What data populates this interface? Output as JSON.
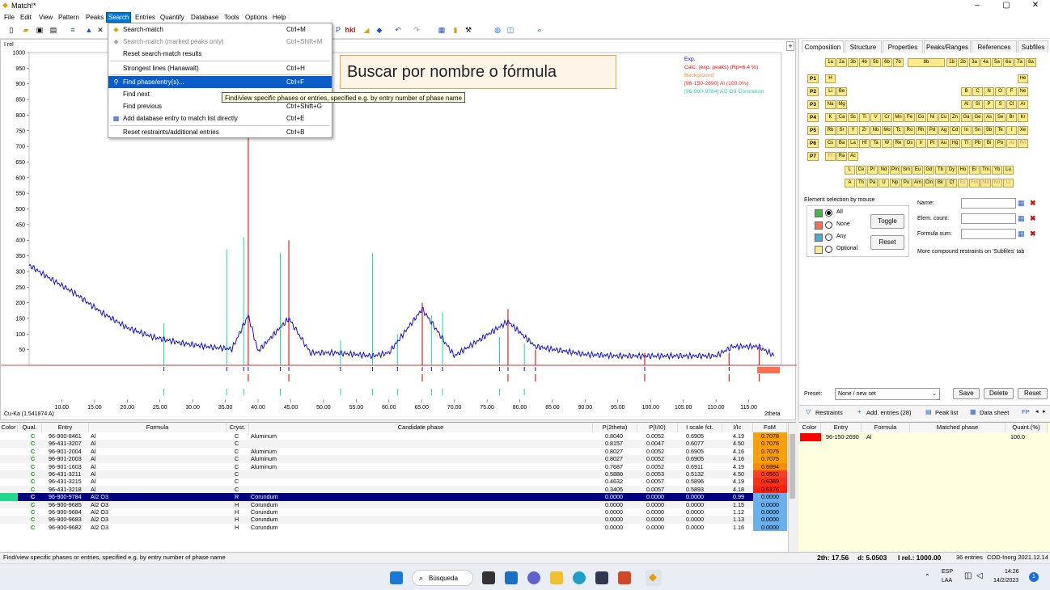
{
  "app": {
    "title": "Match!*",
    "minimize": "–",
    "maximize": "▢",
    "close": "✕"
  },
  "menubar": [
    "File",
    "Edit",
    "View",
    "Pattern",
    "Peaks",
    "Search",
    "Entries",
    "Quantify",
    "Database",
    "Tools",
    "Options",
    "Help"
  ],
  "search_menu": {
    "items": [
      {
        "label": "Search-match",
        "shortcut": "Ctrl+M",
        "state": "normal",
        "icon": "diamond-icon"
      },
      {
        "label": "Search-match (marked peaks only)",
        "shortcut": "Ctrl+Shift+M",
        "state": "disabled",
        "icon": "diamond-gray-icon"
      },
      {
        "label": "Reset search-match results",
        "shortcut": "",
        "state": "normal",
        "icon": ""
      },
      {
        "label": "Strongest lines (Hanawalt)",
        "shortcut": "Ctrl+H",
        "state": "normal",
        "icon": ""
      },
      {
        "label": "Find phase/entry(s)...",
        "shortcut": "Ctrl+F",
        "state": "highlighted",
        "icon": "magnifier-icon"
      },
      {
        "label": "Find next",
        "shortcut": "",
        "state": "normal",
        "icon": ""
      },
      {
        "label": "Find previous",
        "shortcut": "Ctrl+Shift+G",
        "state": "normal",
        "icon": ""
      },
      {
        "label": "Add database entry to match list directly",
        "shortcut": "Ctrl+E",
        "state": "normal",
        "icon": "add-entry-icon"
      },
      {
        "label": "Reset restraints/additional entries",
        "shortcut": "Ctrl+B",
        "state": "normal",
        "icon": ""
      }
    ],
    "tooltip": "Find/view specific phases or entries, specified e.g. by entry number of phase name"
  },
  "annotation": "Buscar por nombre o fórmula",
  "plot": {
    "ylabel": "I rel",
    "yticks": [
      "1000",
      "950",
      "900",
      "850",
      "800",
      "750",
      "700",
      "650",
      "600",
      "550",
      "500",
      "450",
      "400",
      "350",
      "300",
      "250",
      "200",
      "150",
      "100",
      "50"
    ],
    "xticks": [
      "10.00",
      "15.00",
      "20.00",
      "25.00",
      "30.00",
      "35.00",
      "40.00",
      "45.00",
      "50.00",
      "55.00",
      "60.00",
      "65.00",
      "70.00",
      "75.00",
      "80.00",
      "85.00",
      "90.00",
      "95.00",
      "100.00",
      "105.00",
      "110.00",
      "115.00"
    ],
    "xunit": "2theta",
    "wavelength": "Cu-Ka (1.541874 A)",
    "legend": [
      {
        "text": "Exp.",
        "color": "#0000ff"
      },
      {
        "text": "Calc. (exp. peaks) (Rp=6.4 %)",
        "color": "#ff0000"
      },
      {
        "text": "Background",
        "color": "#ff8c40"
      },
      {
        "text": "[96-150-2690] Al  (100.0%)",
        "color": "#ff2020"
      },
      {
        "text": "[96-900-9784] Al2 O3 Corundum",
        "color": "#20d0a0"
      }
    ]
  },
  "chart_data": {
    "type": "line",
    "xlabel": "2theta",
    "ylabel": "I rel",
    "xlim": [
      5,
      120
    ],
    "ylim": [
      0,
      1000
    ],
    "series": [
      {
        "name": "Exp.",
        "x": [
          5,
          8,
          12,
          16,
          20,
          24,
          28,
          32,
          36,
          38.5,
          40,
          44.7,
          48,
          52,
          57.5,
          60,
          65.1,
          70,
          78.2,
          82.4,
          90,
          95,
          100,
          110,
          112.5,
          116.5,
          119
        ],
        "values": [
          320,
          280,
          230,
          170,
          120,
          90,
          72,
          60,
          52,
          160,
          45,
          150,
          40,
          40,
          30,
          40,
          180,
          30,
          140,
          60,
          35,
          30,
          30,
          30,
          60,
          60,
          30
        ]
      }
    ],
    "peaks_al": [
      38.5,
      44.7,
      65.1,
      78.2,
      82.4,
      99.1,
      112.0,
      116.6
    ],
    "peaks_corundum": [
      25.6,
      35.2,
      37.8,
      43.4,
      52.6,
      57.5,
      61.3,
      66.5,
      68.2,
      76.9,
      80.7
    ]
  },
  "right_panel": {
    "tabs": [
      "Composition",
      "Structure",
      "Properties",
      "Peaks/Ranges",
      "References",
      "Subfiles"
    ],
    "groups": [
      "1a",
      "2a",
      "3b",
      "4b",
      "5b",
      "6b",
      "7b",
      "8b",
      "1b",
      "2b",
      "3a",
      "4a",
      "5a",
      "6a",
      "7a",
      "8a"
    ],
    "periods": [
      "P1",
      "P2",
      "P3",
      "P4",
      "P5",
      "P6",
      "P7"
    ],
    "rows": [
      [
        "H",
        "",
        "",
        "",
        "",
        "",
        "",
        "",
        "",
        "",
        "",
        "",
        "",
        "",
        "",
        "",
        "",
        "He"
      ],
      [
        "Li",
        "Be",
        "",
        "",
        "",
        "",
        "",
        "",
        "",
        "",
        "",
        "",
        "B",
        "C",
        "N",
        "O",
        "F",
        "Ne"
      ],
      [
        "Na",
        "Mg",
        "",
        "",
        "",
        "",
        "",
        "",
        "",
        "",
        "",
        "",
        "Al",
        "Si",
        "P",
        "S",
        "Cl",
        "Ar"
      ],
      [
        "K",
        "Ca",
        "Sc",
        "Ti",
        "V",
        "Cr",
        "Mn",
        "Fe",
        "Co",
        "Ni",
        "Cu",
        "Zn",
        "Ga",
        "Ge",
        "As",
        "Se",
        "Br",
        "Kr"
      ],
      [
        "Rb",
        "Sr",
        "Y",
        "Zr",
        "Nb",
        "Mo",
        "Tc",
        "Ru",
        "Rh",
        "Pd",
        "Ag",
        "Cd",
        "In",
        "Sn",
        "Sb",
        "Te",
        "I",
        "Xe"
      ],
      [
        "Cs",
        "Ba",
        "La",
        "Hf",
        "Ta",
        "W",
        "Re",
        "Os",
        "Ir",
        "Pt",
        "Au",
        "Hg",
        "Tl",
        "Pb",
        "Bi",
        "Po",
        "At",
        "Rn"
      ],
      [
        "Fr",
        "Ra",
        "Ac",
        "",
        "",
        "",
        "",
        "",
        "",
        "",
        "",
        "",
        "",
        "",
        "",
        "",
        "",
        ""
      ]
    ],
    "lanth": [
      "L",
      "Ce",
      "Pr",
      "Nd",
      "Pm",
      "Sm",
      "Eu",
      "Gd",
      "Tb",
      "Dy",
      "Ho",
      "Er",
      "Tm",
      "Yb",
      "Lu"
    ],
    "actin": [
      "A",
      "Th",
      "Pa",
      "U",
      "Np",
      "Pu",
      "Am",
      "Cm",
      "Bk",
      "Cf",
      "Es",
      "Fm",
      "Md",
      "No",
      "Lr"
    ],
    "selection_title": "Element selection by mouse",
    "radio": [
      "All",
      "None",
      "Any",
      "Optional"
    ],
    "toggle": "Toggle",
    "reset": "Reset",
    "fields": [
      "Name:",
      "Elem. count:",
      "Formula sum:"
    ],
    "more": "More compound restraints on 'Subfiles' tab",
    "preset_label": "Preset:",
    "preset_value": "None / new set",
    "save": "Save",
    "delete": "Delete",
    "reset_btn": "Reset",
    "bottom_tabs": [
      "Restraints",
      "Add. entries (28)",
      "Peak list",
      "Data sheet",
      "FP"
    ]
  },
  "table": {
    "headers": [
      "Color",
      "Qual.",
      "Entry",
      "Formula",
      "Cryst.",
      "Candidate phase",
      "P(2theta)",
      "P(I/I0)",
      "I scale fct.",
      "I/Ic",
      "FoM"
    ],
    "rows": [
      [
        "C",
        "96-900-8461",
        "Al",
        "C",
        "Aluminum",
        "0.8040",
        "0.0052",
        "0.6905",
        "4.19",
        "0.7078",
        "#ffa000"
      ],
      [
        "C",
        "96-431-3207",
        "Al",
        "C",
        "",
        "0.8157",
        "0.0047",
        "0.6077",
        "4.50",
        "0.7076",
        "#ffa000"
      ],
      [
        "C",
        "96-901-2004",
        "Al",
        "C",
        "Aluminum",
        "0.8027",
        "0.0052",
        "0.6905",
        "4.16",
        "0.7075",
        "#ffa000"
      ],
      [
        "C",
        "96-901-2003",
        "Al",
        "C",
        "Aluminum",
        "0.8027",
        "0.0052",
        "0.6905",
        "4.16",
        "0.7075",
        "#ffa000"
      ],
      [
        "C",
        "96-901-1603",
        "Al",
        "C",
        "Aluminum",
        "0.7687",
        "0.0052",
        "0.6911",
        "4.19",
        "0.6994",
        "#ff8c00"
      ],
      [
        "C",
        "96-431-3211",
        "Al",
        "C",
        "",
        "0.5880",
        "0.0053",
        "0.5132",
        "4.50",
        "0.6563",
        "#ff4020"
      ],
      [
        "C",
        "96-431-3215",
        "Al",
        "C",
        "",
        "0.4632",
        "0.0057",
        "0.5896",
        "4.19",
        "0.6389",
        "#ff3018"
      ],
      [
        "C",
        "96-431-3218",
        "Al",
        "C",
        "",
        "0.3405",
        "0.0057",
        "0.5893",
        "4.18",
        "0.6176",
        "#ff2010"
      ],
      [
        "C",
        "96-900-9784",
        "Al2 O3",
        "R",
        "Corundum",
        "0.0000",
        "0.0000",
        "0.0000",
        "0.99",
        "0.0000",
        "#6ab0ee"
      ],
      [
        "C",
        "96-900-9685",
        "Al2 O3",
        "H",
        "Corundum",
        "0.0000",
        "0.0000",
        "0.0000",
        "1.15",
        "0.0000",
        "#6ab0ee"
      ],
      [
        "C",
        "96-900-9684",
        "Al2 O3",
        "H",
        "Corundum",
        "0.0000",
        "0.0000",
        "0.0000",
        "1.12",
        "0.0000",
        "#6ab0ee"
      ],
      [
        "C",
        "96-900-9683",
        "Al2 O3",
        "H",
        "Corundum",
        "0.0000",
        "0.0000",
        "0.0000",
        "1.13",
        "0.0000",
        "#6ab0ee"
      ],
      [
        "C",
        "96-900-9682",
        "Al2 O3",
        "H",
        "Corundum",
        "0.0000",
        "0.0000",
        "0.0000",
        "1.16",
        "0.0000",
        "#6ab0ee"
      ]
    ]
  },
  "rtable": {
    "headers": [
      "Color",
      "Entry",
      "Formula",
      "Matched phase",
      "Quant.(%)"
    ],
    "row": [
      "96-150-2690",
      "Al",
      "",
      "100.0"
    ]
  },
  "status": {
    "left": "Find/view specific phases or entries, specified e.g. by entry number of phase name",
    "right_2th": "2th: 17.56",
    "right_d": "d: 5.0503",
    "right_irel": "I rel.: 1000.00",
    "entries": "36 entries",
    "db": "COD-Inorg 2021.12.14"
  },
  "taskbar": {
    "search": "Búsqueda",
    "lang1": "ESP",
    "lang2": "LAA",
    "time": "14:26",
    "date": "14/2/2023",
    "notif": "1"
  }
}
